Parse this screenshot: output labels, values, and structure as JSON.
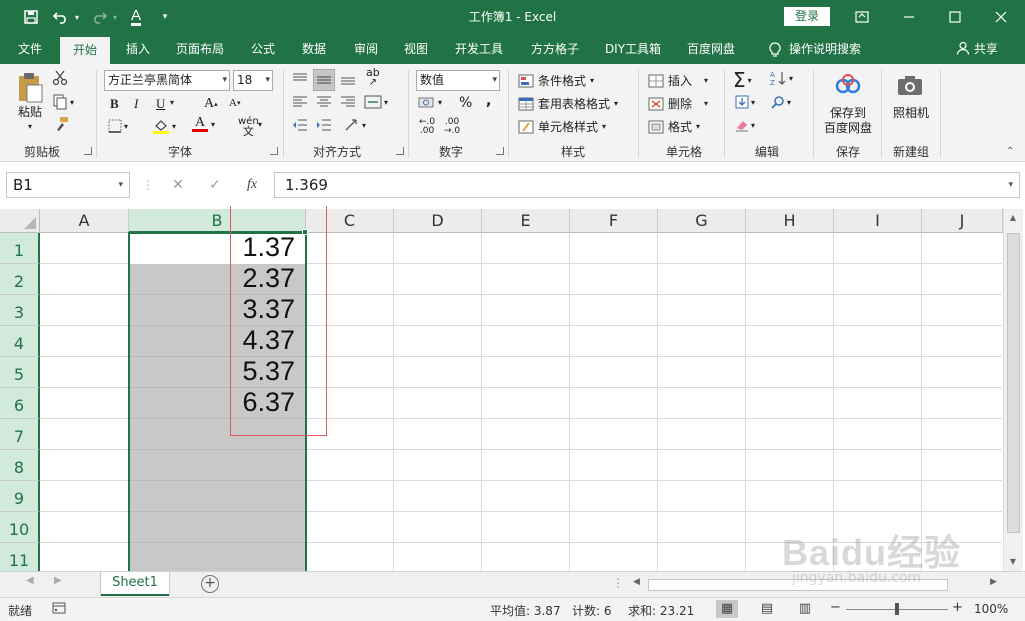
{
  "titlebar": {
    "title": "工作簿1  -  Excel",
    "login_label": "登录",
    "icons": [
      "save-icon",
      "undo-icon",
      "redo-icon",
      "font-color-icon",
      "customize-qat-icon",
      "ribbon-display-icon",
      "minimize-icon",
      "maximize-icon",
      "close-icon"
    ]
  },
  "tabs": {
    "items": [
      {
        "label": "文件",
        "active": false
      },
      {
        "label": "开始",
        "active": true
      },
      {
        "label": "插入",
        "active": false
      },
      {
        "label": "页面布局",
        "active": false
      },
      {
        "label": "公式",
        "active": false
      },
      {
        "label": "数据",
        "active": false
      },
      {
        "label": "审阅",
        "active": false
      },
      {
        "label": "视图",
        "active": false
      },
      {
        "label": "开发工具",
        "active": false
      },
      {
        "label": "方方格子",
        "active": false
      },
      {
        "label": "DIY工具箱",
        "active": false
      },
      {
        "label": "百度网盘",
        "active": false
      },
      {
        "label": "操作说明搜索",
        "active": false
      }
    ],
    "share_label": "共享"
  },
  "ribbon": {
    "clipboard": {
      "paste_label": "粘贴",
      "group_label": "剪贴板"
    },
    "font": {
      "font_name": "方正兰亭黑简体",
      "font_size": "18",
      "bold": "B",
      "italic": "I",
      "underline": "U",
      "grow": "A",
      "shrink": "A",
      "font_color": "A",
      "phonetic": "wén",
      "group_label": "字体"
    },
    "alignment": {
      "wrap": "ab",
      "group_label": "对齐方式"
    },
    "number": {
      "format": "数值",
      "percent": "%",
      "comma": ",",
      "inc_decimal": "←.0",
      "dec_decimal": ".00",
      "group_label": "数字"
    },
    "styles": {
      "conditional": "条件格式",
      "table": "套用表格格式",
      "cell_styles": "单元格样式",
      "group_label": "样式"
    },
    "cells": {
      "insert": "插入",
      "delete": "删除",
      "format": "格式",
      "group_label": "单元格"
    },
    "editing": {
      "sigma": "Σ",
      "group_label": "编辑"
    },
    "save": {
      "label_line1": "保存到",
      "label_line2": "百度网盘",
      "group_label": "保存"
    },
    "camera": {
      "label": "照相机",
      "group_label": "新建组"
    }
  },
  "formula_bar": {
    "name_box": "B1",
    "cancel": "✕",
    "enter": "✓",
    "fx": "fx",
    "value": "1.369"
  },
  "grid": {
    "columns": [
      "A",
      "B",
      "C",
      "D",
      "E",
      "F",
      "G",
      "H",
      "I",
      "J"
    ],
    "selected_column": "B",
    "rows": [
      "1",
      "2",
      "3",
      "4",
      "5",
      "6",
      "7",
      "8",
      "9",
      "10",
      "11"
    ],
    "b_values": [
      "1.37",
      "2.37",
      "3.37",
      "4.37",
      "5.37",
      "6.37"
    ]
  },
  "sheets": {
    "tabs": [
      "Sheet1"
    ],
    "active": "Sheet1",
    "add_label": "+"
  },
  "status": {
    "ready": "就绪",
    "average": "平均值: 3.87",
    "count": "计数: 6",
    "sum": "求和: 23.21",
    "zoom": "100%",
    "zoom_minus": "−",
    "zoom_plus": "+"
  },
  "watermark": {
    "line1": "Baidu经验",
    "line2": "jingyan.baidu.com"
  },
  "colors": {
    "excel_green": "#217346",
    "selected_fill": "#c8c8c8",
    "header_selected": "#d2eadb",
    "annotation_red": "#e05a5a"
  }
}
